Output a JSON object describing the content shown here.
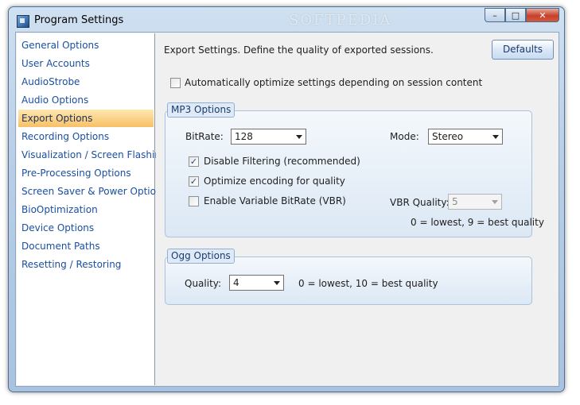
{
  "window": {
    "title": "Program Settings",
    "watermark": "SOFTPEDIA",
    "minimize_glyph": "–",
    "maximize_glyph": "□",
    "close_glyph": "✕"
  },
  "sidebar": {
    "items": [
      {
        "label": "General Options"
      },
      {
        "label": "User Accounts"
      },
      {
        "label": "AudioStrobe"
      },
      {
        "label": "Audio Options"
      },
      {
        "label": "Export Options"
      },
      {
        "label": "Recording Options"
      },
      {
        "label": "Visualization / Screen Flashing"
      },
      {
        "label": "Pre-Processing Options"
      },
      {
        "label": "Screen Saver & Power Options"
      },
      {
        "label": "BioOptimization"
      },
      {
        "label": "Device Options"
      },
      {
        "label": "Document Paths"
      },
      {
        "label": "Resetting / Restoring"
      }
    ],
    "selected": "Export Options"
  },
  "content": {
    "description": "Export Settings. Define the quality of exported sessions.",
    "defaults_label": "Defaults",
    "auto_optimize": {
      "label": "Automatically optimize settings depending on session content",
      "checked": false
    },
    "mp3": {
      "title": "MP3 Options",
      "bitrate_label": "BitRate:",
      "bitrate_value": "128",
      "mode_label": "Mode:",
      "mode_value": "Stereo",
      "disable_filtering": {
        "label": "Disable Filtering (recommended)",
        "checked": true,
        "mark": "✓"
      },
      "optimize_encoding": {
        "label": "Optimize encoding for quality",
        "checked": true,
        "mark": "✓"
      },
      "vbr": {
        "label": "Enable Variable BitRate (VBR)",
        "checked": false
      },
      "vbr_quality_label": "VBR Quality:",
      "vbr_quality_value": "5",
      "vbr_hint": "0 = lowest, 9 = best quality"
    },
    "ogg": {
      "title": "Ogg Options",
      "quality_label": "Quality:",
      "quality_value": "4",
      "quality_hint": "0 = lowest, 10 = best quality"
    }
  }
}
